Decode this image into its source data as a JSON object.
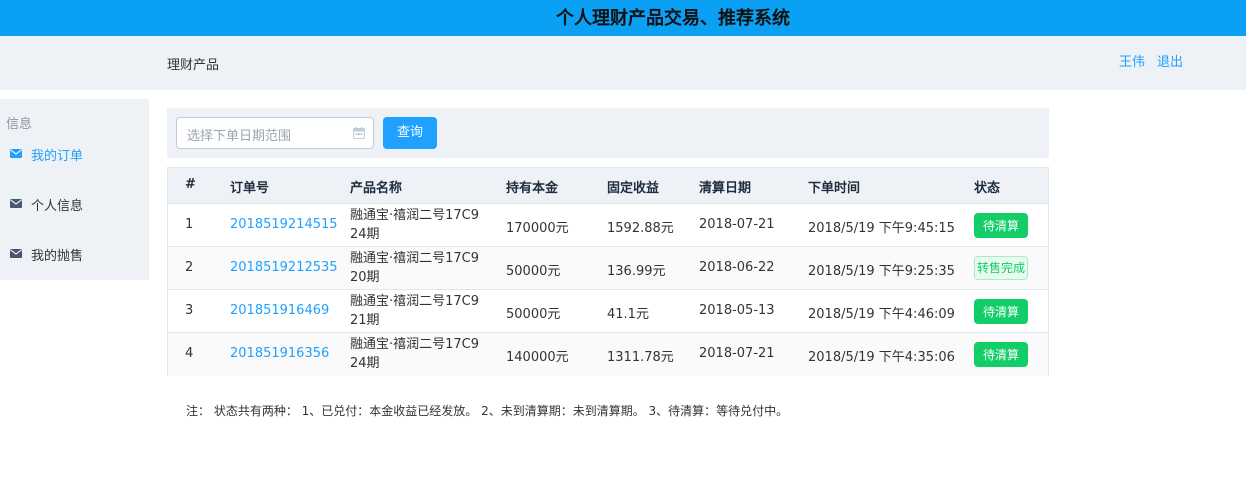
{
  "header": {
    "title": "个人理财产品交易、推荐系统"
  },
  "nav": {
    "product_link": "理财产品",
    "user_name": "王伟",
    "logout": "退出"
  },
  "sidebar": {
    "group_title": "信息",
    "items": [
      {
        "label": "我的订单",
        "icon": "envelope-icon",
        "active": true
      },
      {
        "label": "个人信息",
        "icon": "envelope-icon",
        "active": false
      },
      {
        "label": "我的抛售",
        "icon": "envelope-icon",
        "active": false
      }
    ]
  },
  "filter": {
    "date_placeholder": "选择下单日期范围",
    "query_button": "查询"
  },
  "table": {
    "columns": [
      "#",
      "订单号",
      "产品名称",
      "持有本金",
      "固定收益",
      "清算日期",
      "下单时间",
      "状态"
    ],
    "rows": [
      {
        "index": "1",
        "order_no": "2018519214515",
        "product_line1": "融通宝·禧润二号17C9",
        "product_line2": "24期",
        "principal": "170000元",
        "income": "1592.88元",
        "settle_date": "2018-07-21",
        "order_time": "2018/5/19 下午9:45:15",
        "status": "待清算"
      },
      {
        "index": "2",
        "order_no": "2018519212535",
        "product_line1": "融通宝·禧润二号17C9",
        "product_line2": "20期",
        "principal": "50000元",
        "income": "136.99元",
        "settle_date": "2018-06-22",
        "order_time": "2018/5/19 下午9:25:35",
        "status": "转售完成"
      },
      {
        "index": "3",
        "order_no": "201851916469",
        "product_line1": "融通宝·禧润二号17C9",
        "product_line2": "21期",
        "principal": "50000元",
        "income": "41.1元",
        "settle_date": "2018-05-13",
        "order_time": "2018/5/19 下午4:46:09",
        "status": "待清算"
      },
      {
        "index": "4",
        "order_no": "201851916356",
        "product_line1": "融通宝·禧润二号17C9",
        "product_line2": "24期",
        "principal": "140000元",
        "income": "1311.78元",
        "settle_date": "2018-07-21",
        "order_time": "2018/5/19 下午4:35:06",
        "status": "待清算"
      }
    ]
  },
  "note": "注： 状态共有两种： 1、已兑付：本金收益已经发放。 2、未到清算期：未到清算期。 3、待清算：等待兑付中。",
  "colors": {
    "header_blue": "#0aa1f5",
    "primary": "#20a0ff",
    "success": "#13ce66",
    "panel_bg": "#eef1f6"
  }
}
